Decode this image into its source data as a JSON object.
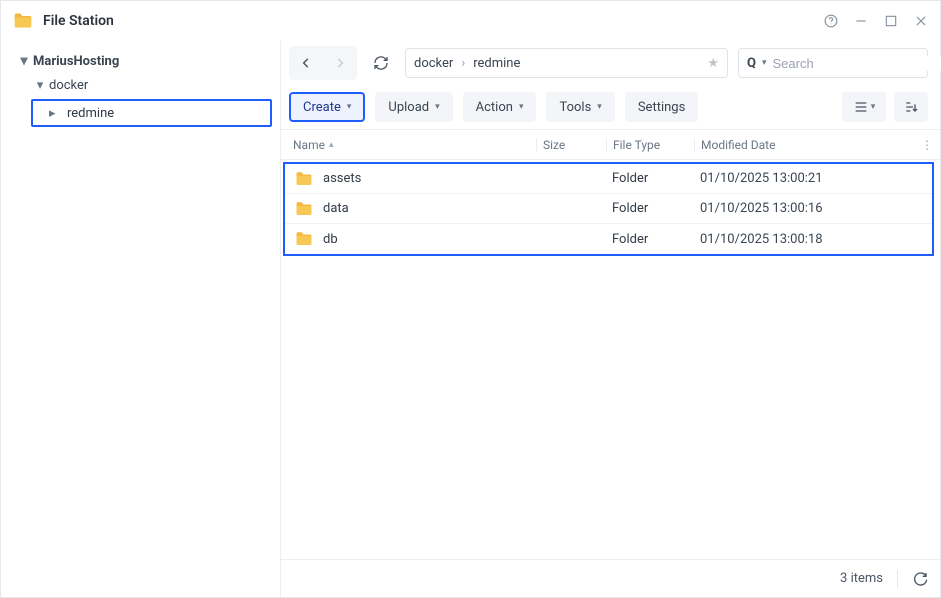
{
  "app": {
    "title": "File Station"
  },
  "tree": {
    "root": {
      "label": "MariusHosting"
    },
    "child1": {
      "label": "docker"
    },
    "child2": {
      "label": "redmine"
    }
  },
  "breadcrumb": [
    "docker",
    "redmine"
  ],
  "search": {
    "placeholder": "Search"
  },
  "toolbar": {
    "create": "Create",
    "upload": "Upload",
    "action": "Action",
    "tools": "Tools",
    "settings": "Settings"
  },
  "columns": {
    "name": "Name",
    "size": "Size",
    "type": "File Type",
    "modified": "Modified Date"
  },
  "rows": [
    {
      "name": "assets",
      "size": "",
      "type": "Folder",
      "modified": "01/10/2025 13:00:21"
    },
    {
      "name": "data",
      "size": "",
      "type": "Folder",
      "modified": "01/10/2025 13:00:16"
    },
    {
      "name": "db",
      "size": "",
      "type": "Folder",
      "modified": "01/10/2025 13:00:18"
    }
  ],
  "status": {
    "count": "3 items"
  }
}
